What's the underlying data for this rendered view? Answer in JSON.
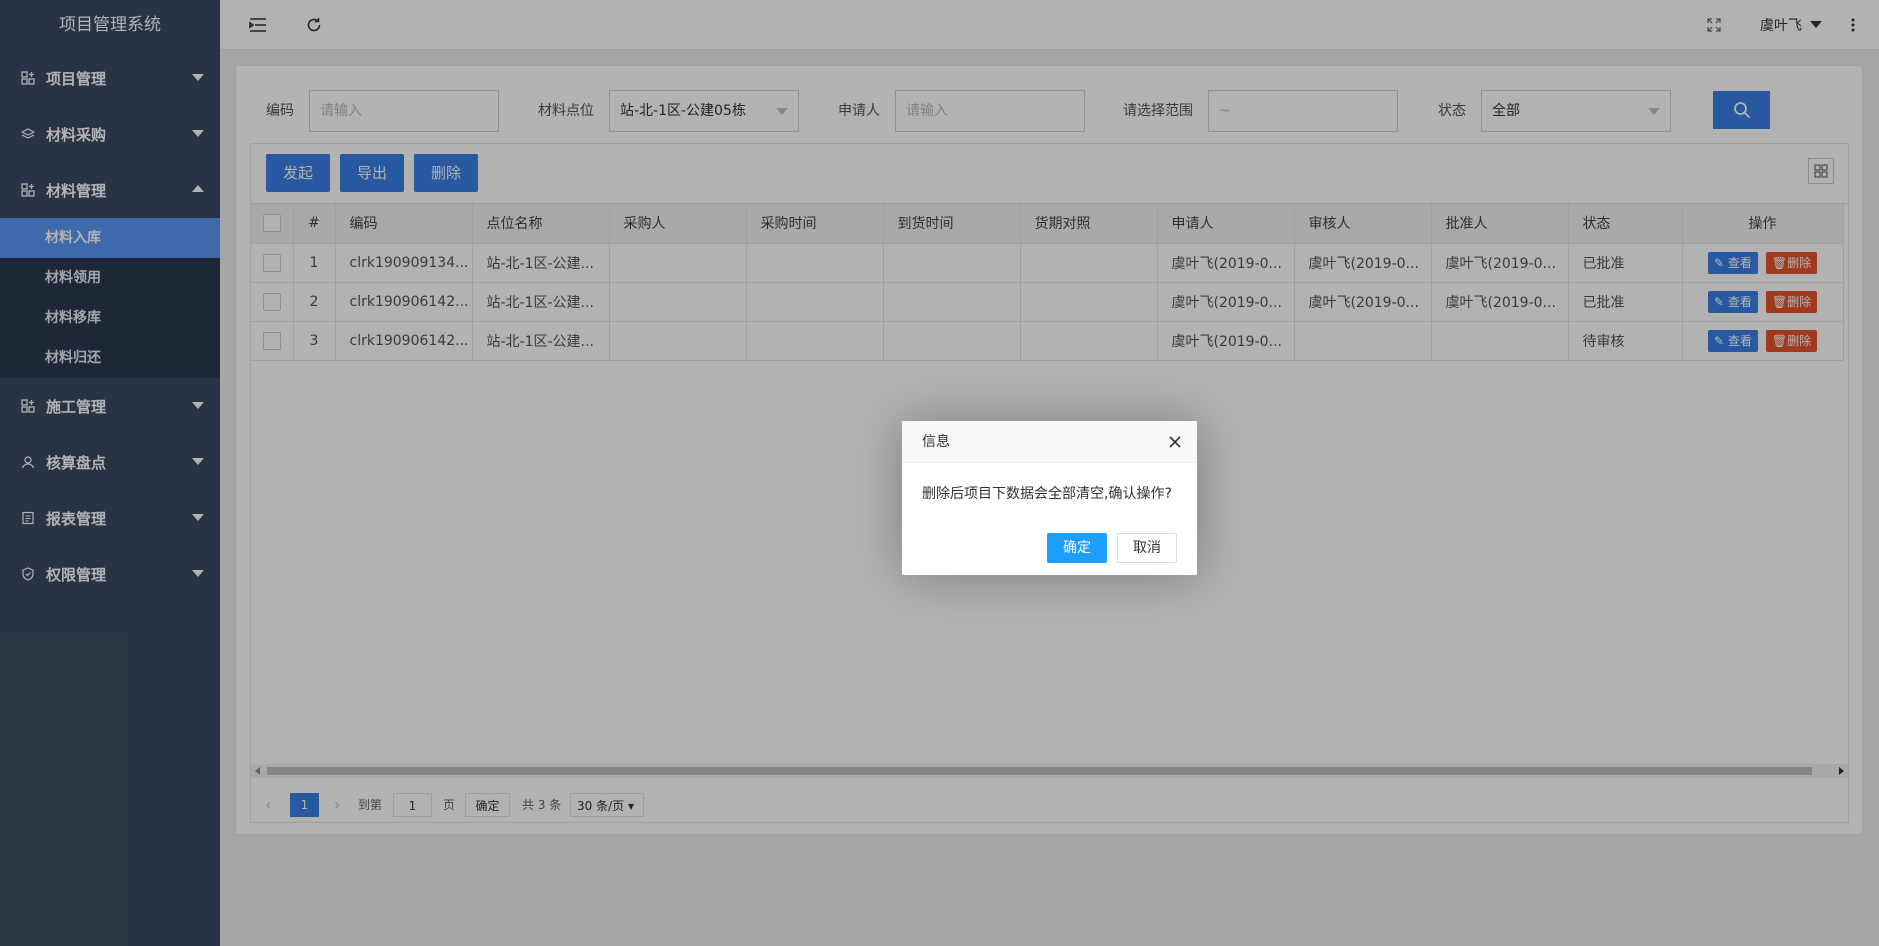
{
  "app": {
    "title": "项目管理系统"
  },
  "sidebar": {
    "items": [
      {
        "label": "项目管理",
        "icon": "apps-icon",
        "expanded": false
      },
      {
        "label": "材料采购",
        "icon": "layers-icon",
        "expanded": false
      },
      {
        "label": "材料管理",
        "icon": "apps-icon",
        "expanded": true,
        "children": [
          {
            "label": "材料入库",
            "active": true
          },
          {
            "label": "材料领用"
          },
          {
            "label": "材料移库"
          },
          {
            "label": "材料归还"
          }
        ]
      },
      {
        "label": "施工管理",
        "icon": "apps-icon",
        "expanded": false
      },
      {
        "label": "核算盘点",
        "icon": "user-icon",
        "expanded": false
      },
      {
        "label": "报表管理",
        "icon": "report-icon",
        "expanded": false
      },
      {
        "label": "权限管理",
        "icon": "shield-icon",
        "expanded": false
      }
    ]
  },
  "header": {
    "user_name": "虞叶飞"
  },
  "filters": {
    "code": {
      "label": "编码",
      "placeholder": "请输入"
    },
    "point": {
      "label": "材料点位",
      "value": "站-北-1区-公建05栋"
    },
    "applicant": {
      "label": "申请人",
      "placeholder": "请输入"
    },
    "range": {
      "label": "请选择范围",
      "placeholder": "~"
    },
    "status": {
      "label": "状态",
      "value": "全部"
    }
  },
  "toolbar": {
    "launch": "发起",
    "export": "导出",
    "delete": "删除"
  },
  "table": {
    "headers": [
      "#",
      "编码",
      "点位名称",
      "采购人",
      "采购时间",
      "到货时间",
      "货期对照",
      "申请人",
      "审核人",
      "批准人",
      "状态",
      "操作"
    ],
    "rows": [
      {
        "no": "1",
        "code": "clrk190909134...",
        "point": "站-北-1区-公建...",
        "buyer": "",
        "buy_time": "",
        "arrive_time": "",
        "compare": "",
        "applicant": "虞叶飞(2019-0...",
        "reviewer": "虞叶飞(2019-0...",
        "approver": "虞叶飞(2019-0...",
        "status": "已批准",
        "status_type": "ok"
      },
      {
        "no": "2",
        "code": "clrk190906142...",
        "point": "站-北-1区-公建...",
        "buyer": "",
        "buy_time": "",
        "arrive_time": "",
        "compare": "",
        "applicant": "虞叶飞(2019-0...",
        "reviewer": "虞叶飞(2019-0...",
        "approver": "虞叶飞(2019-0...",
        "status": "已批准",
        "status_type": "ok"
      },
      {
        "no": "3",
        "code": "clrk190906142...",
        "point": "站-北-1区-公建...",
        "buyer": "",
        "buy_time": "",
        "arrive_time": "",
        "compare": "",
        "applicant": "虞叶飞(2019-0...",
        "reviewer": "",
        "approver": "",
        "status": "待审核",
        "status_type": "wait"
      }
    ],
    "ops": {
      "view": "查看",
      "delete": "删除"
    }
  },
  "pager": {
    "current": "1",
    "goto_label": "到第",
    "goto_value": "1",
    "page_unit": "页",
    "confirm": "确定",
    "total": "共 3 条",
    "page_size": "30 条/页"
  },
  "modal": {
    "title": "信息",
    "message": "删除后项目下数据会全部清空,确认操作?",
    "ok": "确定",
    "cancel": "取消"
  },
  "colors": {
    "sidebar_bg": "#3c4a63",
    "active_item": "#5a97f4",
    "primary": "#3a7ee6",
    "danger": "#e6542c",
    "success": "#3db33d",
    "modal_ok": "#1e9fff"
  }
}
